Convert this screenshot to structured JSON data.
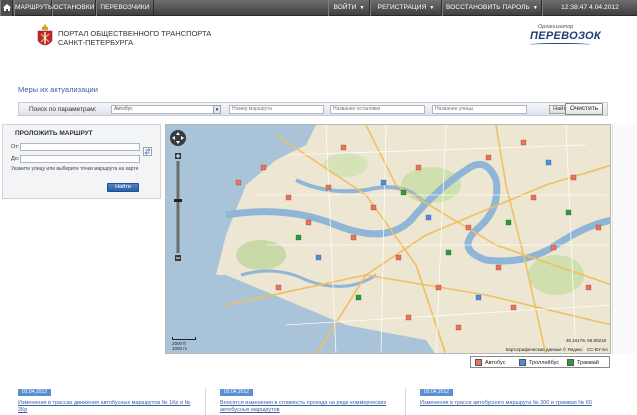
{
  "nav": {
    "items": [
      {
        "label": "МАРШРУТЫ"
      },
      {
        "label": "ОСТАНОВКИ"
      },
      {
        "label": "ПЕРЕВОЗЧИКИ"
      }
    ],
    "right": [
      {
        "label": "ВОЙТИ"
      },
      {
        "label": "РЕГИСТРАЦИЯ"
      },
      {
        "label": "ВОССТАНОВИТЬ ПАРОЛЬ"
      }
    ],
    "datetime": "12:38:47 4.04.2012"
  },
  "header": {
    "title_line1": "ПОРТАЛ ОБЩЕСТВЕННОГО ТРАНСПОРТА",
    "title_line2": "САНКТ-ПЕТЕРБУРГА",
    "brand_org": "Организатор",
    "brand_name": "ПЕРЕВОЗОК"
  },
  "update_link": "Меры их актуализации",
  "search": {
    "label": "Поиск по параметрам:",
    "transport_type": "Автобус",
    "route_placeholder": "Номер маршрута",
    "stop_placeholder": "Название остановки",
    "street_placeholder": "Название улицы",
    "find_label": "Найти",
    "clear_label": "Очистить"
  },
  "route": {
    "title": "ПРОЛОЖИТЬ МАРШРУТ",
    "from_label": "От:",
    "to_label": "До:",
    "hint": "Укажите улицу или выберите точки маршрута на карте",
    "go_label": "Найти"
  },
  "map": {
    "scale_top": "2000 ft",
    "scale_bottom": "1000 m",
    "coords": "30.16179, 59.90218",
    "copyright": "Картографические данные © Яндекс",
    "copyright_right": "CC-BY-SA"
  },
  "legend": {
    "items": [
      {
        "label": "Автобус",
        "color": "#e9735b"
      },
      {
        "label": "Троллейбус",
        "color": "#4f8fd8"
      },
      {
        "label": "Трамвай",
        "color": "#2e9a3e"
      }
    ]
  },
  "news": [
    {
      "date": "02.04.2012",
      "text": "Изменения в трассах движения автобусных маршрутов № 1Кр и № 2Кр"
    },
    {
      "date": "02.04.2012",
      "text": "Вносятся изменения в стоимость проезда на ряде коммерческих автобусных маршрутов"
    },
    {
      "date": "02.04.2012",
      "text": "Изменения в трассе автобусного маршрута № 300 и трамвая № 60"
    }
  ]
}
